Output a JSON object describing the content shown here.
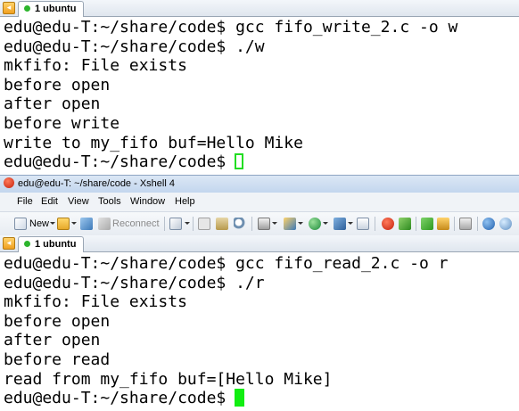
{
  "top_window": {
    "tab_label": "1 ubuntu",
    "lines": [
      "edu@edu-T:~/share/code$ gcc fifo_write_2.c -o w",
      "edu@edu-T:~/share/code$ ./w",
      "mkfifo: File exists",
      "before open",
      "after open",
      "before write",
      "write to my_fifo buf=Hello Mike",
      "edu@edu-T:~/share/code$"
    ]
  },
  "xshell": {
    "title": "edu@edu-T: ~/share/code - Xshell 4",
    "menu": [
      "File",
      "Edit",
      "View",
      "Tools",
      "Window",
      "Help"
    ],
    "toolbar": {
      "new_label": "New",
      "reconnect_label": "Reconnect"
    },
    "tab_label": "1 ubuntu",
    "lines": [
      "edu@edu-T:~/share/code$ gcc fifo_read_2.c -o r",
      "edu@edu-T:~/share/code$ ./r",
      "mkfifo: File exists",
      "before open",
      "after open",
      "before read",
      "read from my_fifo buf=[Hello Mike]",
      "edu@edu-T:~/share/code$"
    ]
  },
  "colors": {
    "cursor": "#11ee11",
    "tab_status": "#2db52d",
    "nav_button": "#f0a020"
  },
  "icons": [
    "tab-nav-icon",
    "session-status-icon",
    "xshell-app-icon",
    "new-session-icon",
    "open-folder-icon",
    "reconnect-icon",
    "properties-icon",
    "copy-icon",
    "paste-icon",
    "find-icon",
    "print-icon",
    "transfer-icon",
    "globe-icon",
    "font-icon",
    "fullscreen-icon",
    "xftp-icon",
    "xmanager-icon",
    "layout-icon",
    "lock-icon",
    "keyboard-icon",
    "help-icon",
    "chat-icon"
  ]
}
